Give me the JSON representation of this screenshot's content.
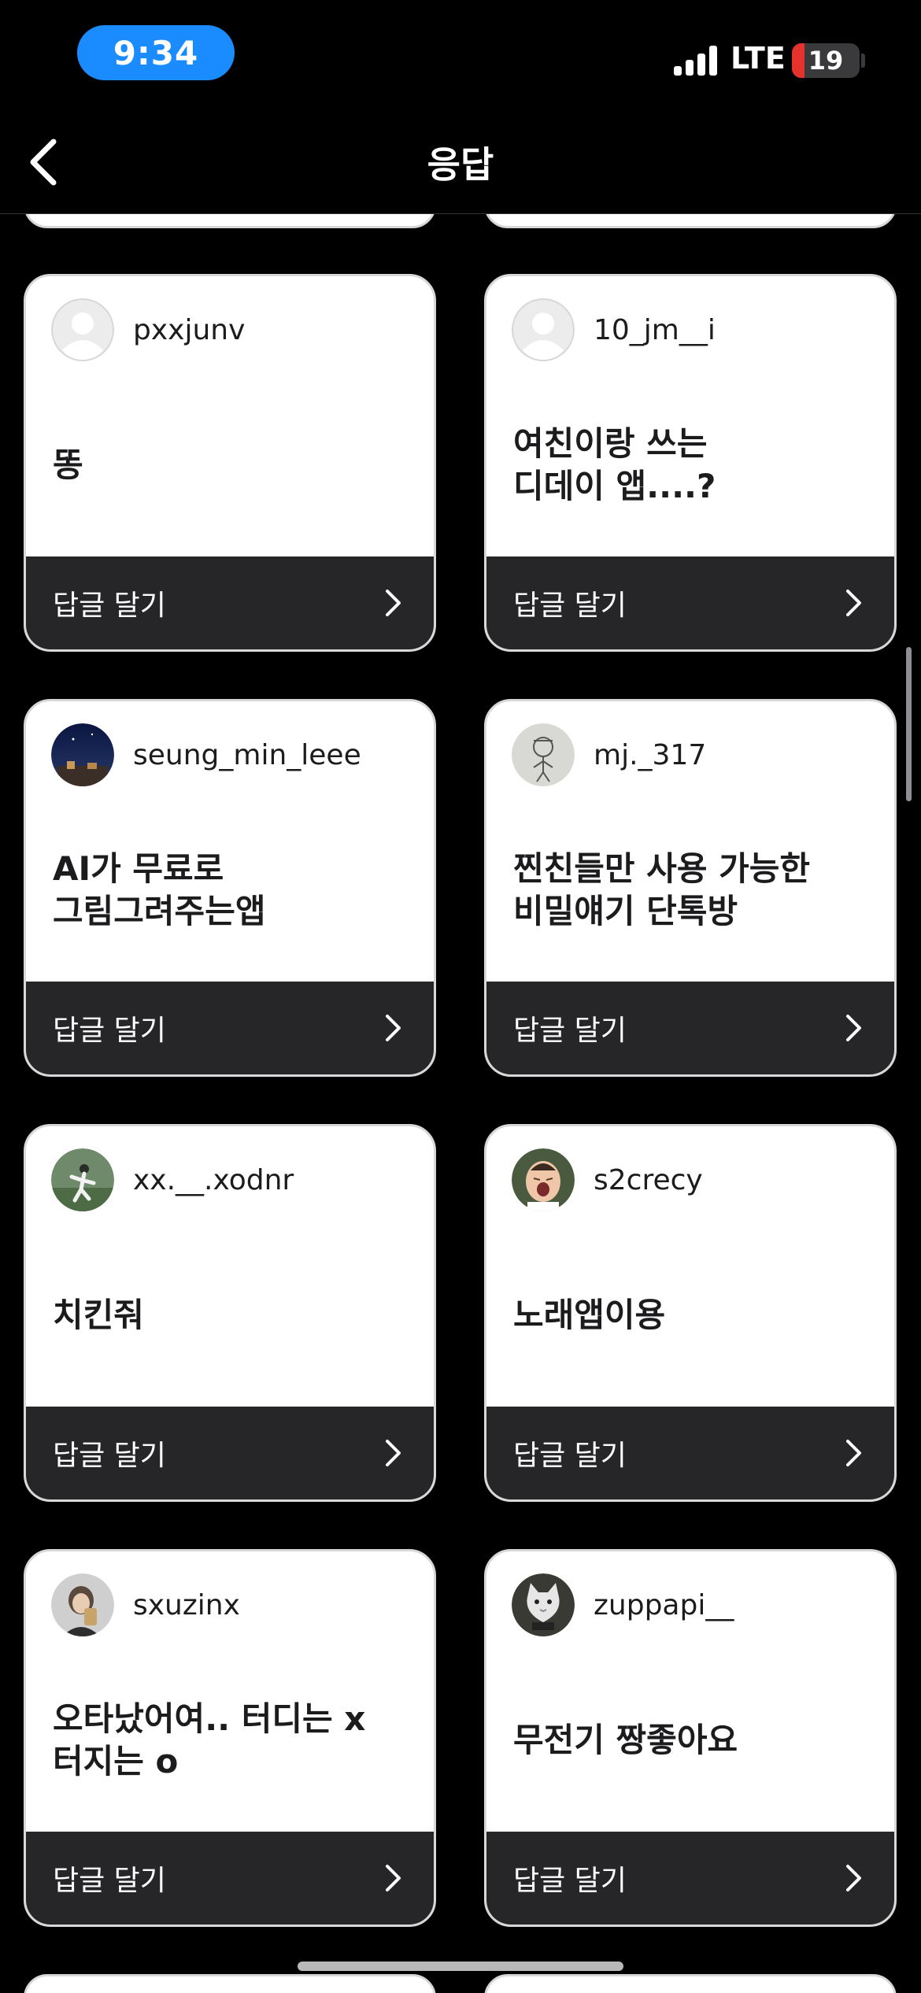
{
  "status_bar": {
    "time": "9:34",
    "network": "LTE",
    "battery": "19",
    "battery_level": 0.19
  },
  "nav": {
    "title": "응답",
    "back_icon": "chevron-left-icon"
  },
  "reply_label": "답글 달기",
  "chevron_icon": "chevron-right-icon",
  "avatar_placeholder_icon": "default-profile-icon",
  "cards": [
    {
      "username": "pxxjunv",
      "text": "똥",
      "avatar": "default"
    },
    {
      "username": "10_jm__i",
      "text": "여친이랑 쓰는\n디데이 앱....?",
      "avatar": "default"
    },
    {
      "username": "seung_min_leee",
      "text": "AI가 무료로\n그림그려주는앱",
      "avatar": "night-sky-photo"
    },
    {
      "username": "mj._317",
      "text": "찐친들만 사용 가능한\n비밀얘기 단톡방",
      "avatar": "doodle-character"
    },
    {
      "username": "xx.__.xodnr",
      "text": "치킨줘",
      "avatar": "sports-photo"
    },
    {
      "username": "s2crecy",
      "text": "노래앱이용",
      "avatar": "crying-baby-photo"
    },
    {
      "username": "sxuzinx",
      "text": "오타났어여.. 터디는 x\n터지는 o",
      "avatar": "selfie-photo"
    },
    {
      "username": "zuppapi__",
      "text": "무전기 짱좋아요",
      "avatar": "cat-photo"
    }
  ],
  "colors": {
    "background": "#000000",
    "card": "#ffffff",
    "card_footer": "#262628",
    "time_pill": "#1a8cff",
    "battery_low": "#e5322d"
  }
}
